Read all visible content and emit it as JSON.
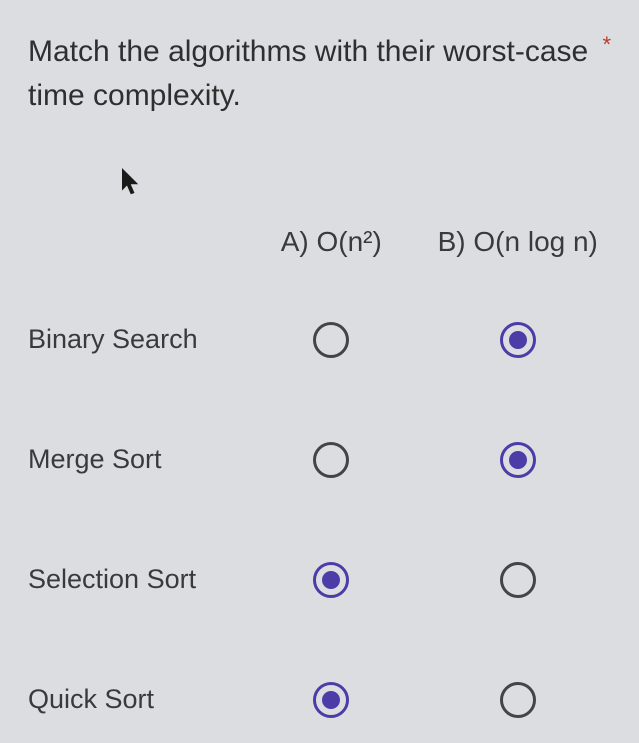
{
  "question": {
    "text": "Match the algorithms with their worst-case time complexity.",
    "required_mark": "*"
  },
  "columns": [
    {
      "label": "A) O(n²)"
    },
    {
      "label": "B) O(n log n)"
    }
  ],
  "rows": [
    {
      "label": "Binary Search",
      "selected_col": 1
    },
    {
      "label": "Merge Sort",
      "selected_col": 1
    },
    {
      "label": "Selection Sort",
      "selected_col": 0
    },
    {
      "label": "Quick Sort",
      "selected_col": 0
    }
  ]
}
